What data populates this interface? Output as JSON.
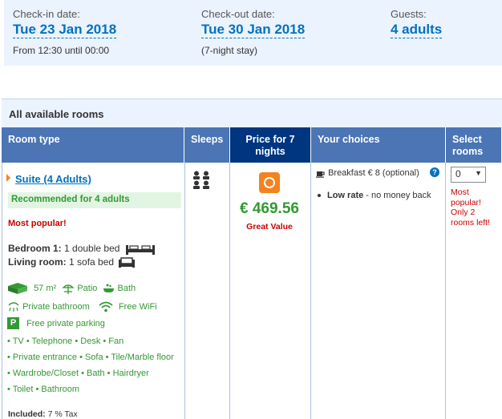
{
  "search": {
    "checkin": {
      "label": "Check-in date:",
      "value": "Tue 23 Jan 2018",
      "sub": "From 12:30 until 00:00"
    },
    "checkout": {
      "label": "Check-out date:",
      "value": "Tue 30 Jan 2018",
      "sub": "(7-night stay)"
    },
    "guests": {
      "label": "Guests:",
      "value": "4 adults"
    }
  },
  "rooms": {
    "title": "All available rooms",
    "headers": {
      "room_type": "Room type",
      "sleeps": "Sleeps",
      "price": "Price for 7 nights",
      "choices": "Your choices",
      "select": "Select rooms"
    },
    "room": {
      "name": "Suite (4 Adults)",
      "recommended": "Recommended for 4 adults",
      "popular": "Most popular!",
      "beds": [
        {
          "room": "Bedroom 1:",
          "desc": "1 double bed"
        },
        {
          "room": "Living room:",
          "desc": "1 sofa bed"
        }
      ],
      "size": "57 m²",
      "facilities_top": [
        "Patio",
        "Bath"
      ],
      "private_bathroom": "Private bathroom",
      "wifi": "Free WiFi",
      "parking": "Free private parking",
      "parking_icon": "P",
      "amenities_lines": [
        "• TV  • Telephone  • Desk  • Fan",
        "• Private entrance  • Sofa  • Tile/Marble floor",
        "• Wardrobe/Closet  • Bath  • Hairdryer",
        "• Toilet  • Bathroom"
      ],
      "included_label": "Included:",
      "included_value": "7 % Tax",
      "price": "€ 469.56",
      "price_note": "Great Value",
      "breakfast": "Breakfast € 8 (optional)",
      "help_icon": "?",
      "low_rate_label": "Low rate",
      "low_rate_text": " - no money back",
      "select_value": "0",
      "select_note": "Most popular! Only 2 rooms left!"
    }
  },
  "colors": {
    "accent_blue": "#0071c2",
    "header_blue": "#4b75b5",
    "price_header": "#003580",
    "green": "#339933",
    "red": "#cc0000",
    "orange": "#f58220"
  },
  "icons": [
    "sleeps-icon",
    "double-bed-icon",
    "sofa-bed-icon",
    "room-size-icon",
    "patio-icon",
    "bath-icon",
    "shower-icon",
    "wifi-icon",
    "parking-icon",
    "value-badge-icon",
    "coffee-icon",
    "help-icon",
    "chevron-down-icon"
  ]
}
